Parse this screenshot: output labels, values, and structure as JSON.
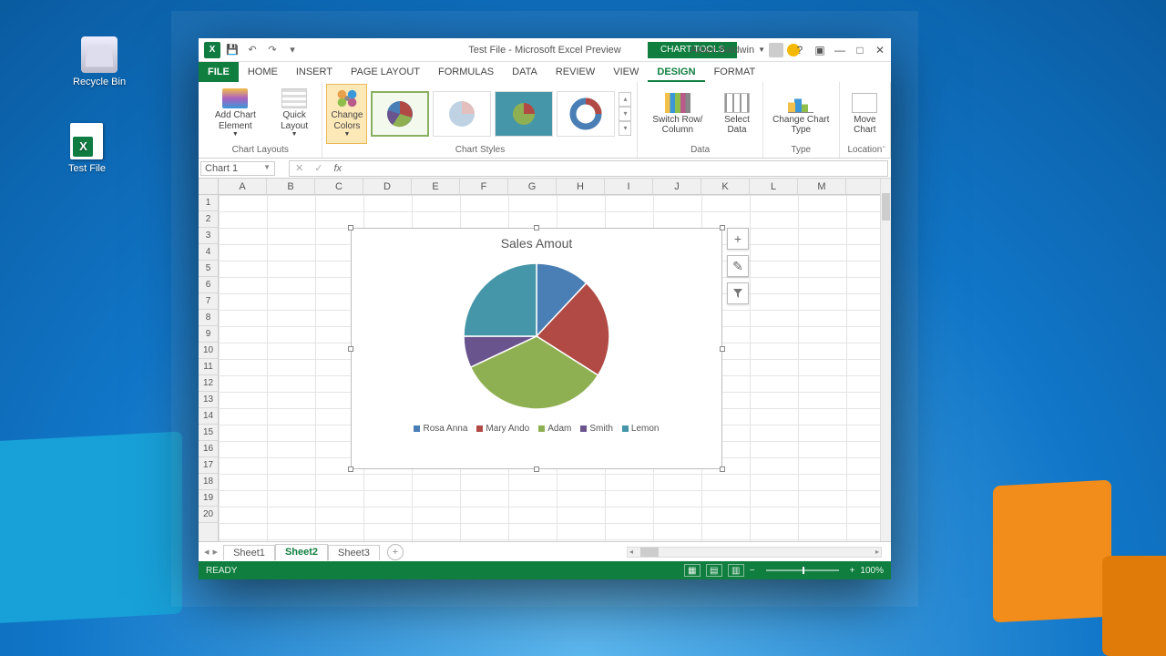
{
  "desktop": {
    "recycle": "Recycle Bin",
    "testfile": "Test File"
  },
  "window": {
    "title": "Test File - Microsoft Excel Preview",
    "tool_tab": "CHART TOOLS",
    "user": "Adam Baldwin"
  },
  "tabs": {
    "file": "FILE",
    "home": "HOME",
    "insert": "INSERT",
    "pagelayout": "PAGE LAYOUT",
    "formulas": "FORMULAS",
    "data": "DATA",
    "review": "REVIEW",
    "view": "VIEW",
    "design": "DESIGN",
    "format": "FORMAT"
  },
  "ribbon": {
    "add_element": "Add Chart Element",
    "quick": "Quick Layout",
    "colors": "Change Colors",
    "g_layouts": "Chart Layouts",
    "g_styles": "Chart Styles",
    "switch": "Switch Row/ Column",
    "select": "Select Data",
    "g_data": "Data",
    "chtype": "Change Chart Type",
    "g_type": "Type",
    "move": "Move Chart",
    "g_loc": "Location"
  },
  "namebox": "Chart 1",
  "cols": [
    "A",
    "B",
    "C",
    "D",
    "E",
    "F",
    "G",
    "H",
    "I",
    "J",
    "K",
    "L",
    "M"
  ],
  "rows": [
    "1",
    "2",
    "3",
    "4",
    "5",
    "6",
    "7",
    "8",
    "9",
    "10",
    "11",
    "12",
    "13",
    "14",
    "15",
    "16",
    "17",
    "18",
    "19",
    "20"
  ],
  "chart_btns": {
    "add": "+",
    "style": "✎",
    "filter": "▼"
  },
  "sheets": {
    "s1": "Sheet1",
    "s2": "Sheet2",
    "s3": "Sheet3"
  },
  "status": {
    "ready": "READY",
    "zoom": "100%"
  },
  "chart_data": {
    "type": "pie",
    "title": "Sales Amout",
    "series": [
      {
        "name": "Rosa Anna",
        "value": 12,
        "color": "#4a7fb5"
      },
      {
        "name": "Mary Ando",
        "value": 22,
        "color": "#b14a44"
      },
      {
        "name": "Adam",
        "value": 34,
        "color": "#8fb052"
      },
      {
        "name": "Smith",
        "value": 7,
        "color": "#6a548e"
      },
      {
        "name": "Lemon",
        "value": 25,
        "color": "#4596a8"
      }
    ]
  }
}
